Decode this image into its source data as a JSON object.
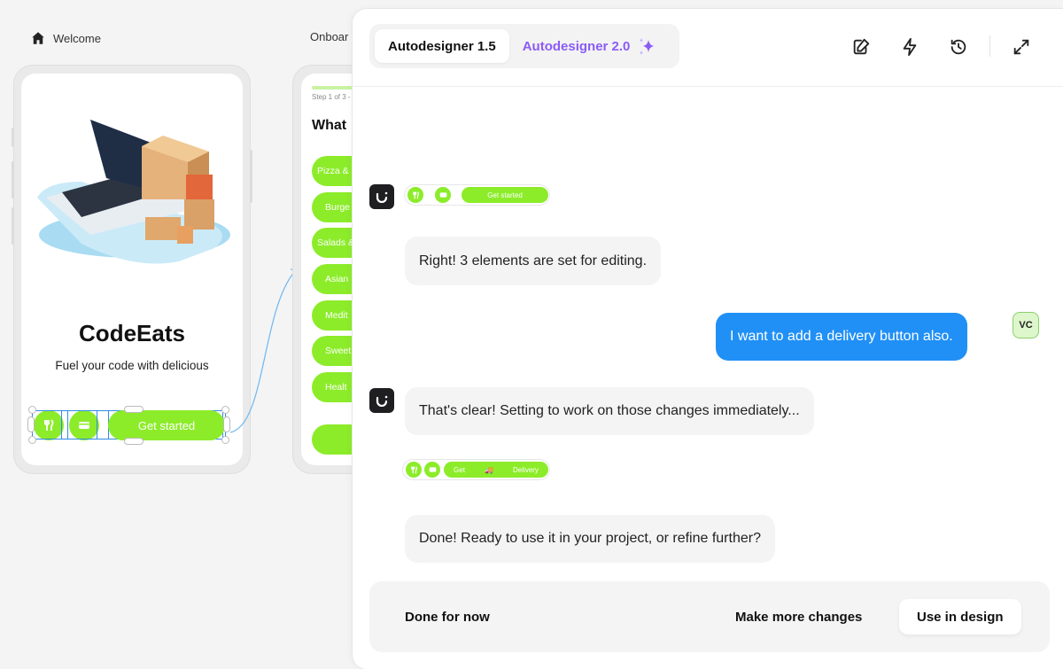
{
  "canvas": {
    "frames": [
      {
        "label": "Welcome",
        "icon": "home-icon"
      },
      {
        "label": "Onboar"
      }
    ]
  },
  "welcome_frame": {
    "title": "CodeEats",
    "subtitle": "Fuel your code with delicious",
    "illustration": "laptop-with-boxes",
    "selection": {
      "icon1": "utensils-icon",
      "icon2": "card-icon",
      "cta": "Get started"
    }
  },
  "onboarding_frame": {
    "step": "Step 1 of 3 -",
    "question": "What",
    "options": [
      "Pizza &",
      "Burge",
      "Salads &",
      "Asian",
      "Medit",
      "Sweet",
      "Healt"
    ]
  },
  "panel": {
    "tabs": [
      {
        "label": "Autodesigner 1.5",
        "active": true
      },
      {
        "label": "Autodesigner 2.0",
        "icon": "sparkle-icon",
        "active": false
      }
    ],
    "header_icons": [
      "edit-icon",
      "lightning-icon",
      "history-icon",
      "expand-icon"
    ],
    "colors": {
      "accent_purple": "#8b5cf6",
      "user_bubble": "#2090f6",
      "lime": "#8cec2a"
    },
    "messages": [
      {
        "role": "bot",
        "type": "preview",
        "cta": "Get started"
      },
      {
        "role": "bot",
        "text": "Right! 3 elements are set for editing."
      },
      {
        "role": "user",
        "text": "I want to add a delivery button also.",
        "avatar": "VC"
      },
      {
        "role": "bot",
        "text": "That's clear! Setting to work on those changes immediately..."
      },
      {
        "role": "bot",
        "type": "preview",
        "cta_left": "Get",
        "cta_right": "Delivery"
      },
      {
        "role": "bot",
        "text": "Done! Ready to use it in your project, or refine further?"
      }
    ],
    "footer": {
      "done": "Done for now",
      "more": "Make more changes",
      "use": "Use in design"
    }
  }
}
